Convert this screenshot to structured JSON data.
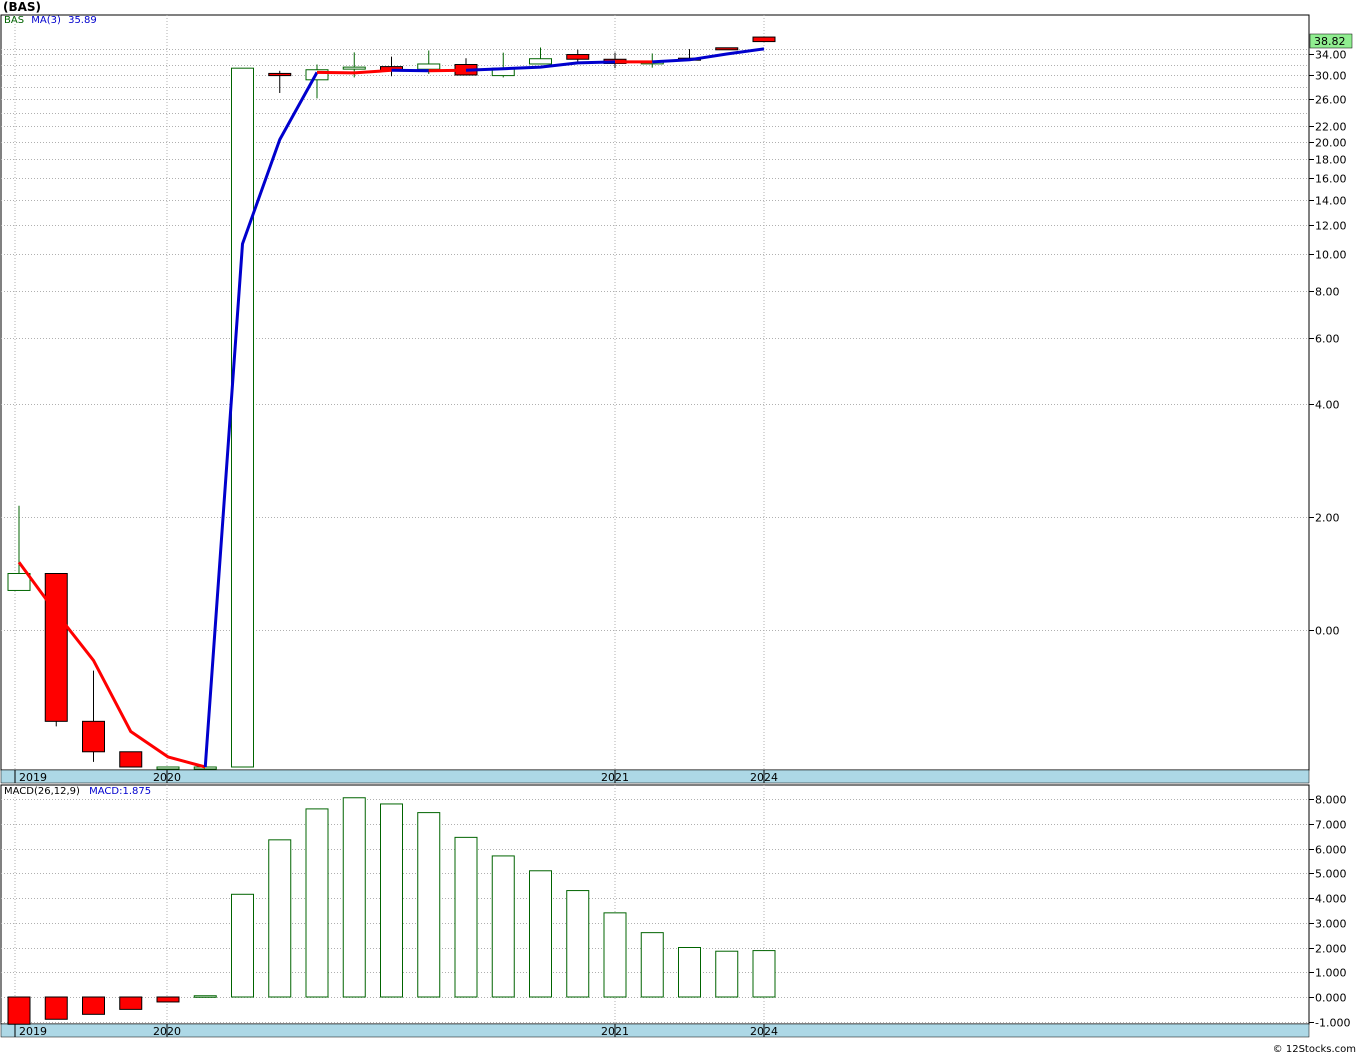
{
  "title": "(BAS)",
  "copyright": "© 12Stocks.com",
  "colors": {
    "up_candle": "#006400",
    "down_candle": "#ff0000",
    "ma_red": "#ff0000",
    "ma_blue": "#0000cd",
    "date_bar": "#add8e6",
    "grid": "#b0b0b0",
    "price_badge": "#90ee90"
  },
  "chart_data": [
    {
      "type": "candlestick",
      "ticker": "BAS",
      "legend": {
        "symbol": "BAS",
        "ma_label": "MA(3)",
        "ma_value": "35.89"
      },
      "scale": "nonlinear",
      "y_ticks": [
        "34.00",
        "30.00",
        "26.00",
        "22.00",
        "20.00",
        "18.00",
        "16.00",
        "14.00",
        "12.00",
        "10.00",
        "8.00",
        "6.00",
        "4.00",
        "2.00",
        "0.00"
      ],
      "last_price": "38.82",
      "x_tick_labels": [
        "2019",
        "2020",
        "2021",
        "2024"
      ],
      "candles": [
        {
          "open": 0.7,
          "high": 2.2,
          "low": 0.7,
          "close": 1.0
        },
        {
          "open": 1.0,
          "high": 1.0,
          "low": -1.9,
          "close": -1.8
        },
        {
          "open": -1.8,
          "high": -0.8,
          "low": -2.6,
          "close": -2.4
        },
        {
          "open": -2.4,
          "high": -2.6,
          "low": -2.6,
          "close": -2.7
        },
        {
          "open": -2.7,
          "high": -2.7,
          "low": -2.7,
          "close": -2.7
        },
        {
          "open": -2.7,
          "high": -2.7,
          "low": -2.7,
          "close": -2.7
        },
        {
          "open": -2.7,
          "high": 31.3,
          "low": -2.7,
          "close": 31.3
        },
        {
          "open": 30.3,
          "high": 30.8,
          "low": 27.0,
          "close": 29.9
        },
        {
          "open": 29.2,
          "high": 32.0,
          "low": 26.1,
          "close": 31.0
        },
        {
          "open": 31.2,
          "high": 34.6,
          "low": 29.6,
          "close": 31.5
        },
        {
          "open": 31.6,
          "high": 33.5,
          "low": 29.8,
          "close": 30.9
        },
        {
          "open": 31.1,
          "high": 35.3,
          "low": 30.2,
          "close": 32.1
        },
        {
          "open": 32.0,
          "high": 33.2,
          "low": 30.0,
          "close": 30.0
        },
        {
          "open": 29.9,
          "high": 34.5,
          "low": 29.6,
          "close": 31.3
        },
        {
          "open": 32.1,
          "high": 36.4,
          "low": 32.0,
          "close": 33.1
        },
        {
          "open": 33.9,
          "high": 35.6,
          "low": 32.1,
          "close": 33.0
        },
        {
          "open": 33.0,
          "high": 34.5,
          "low": 31.3,
          "close": 32.2
        },
        {
          "open": 32.5,
          "high": 34.2,
          "low": 31.4,
          "close": 32.5
        },
        {
          "open": 33.2,
          "high": 35.8,
          "low": 33.2,
          "close": 33.0
        },
        {
          "open": 36.3,
          "high": 36.4,
          "low": 35.7,
          "close": 36.0
        },
        {
          "open": 39.4,
          "high": 39.4,
          "low": 38.5,
          "close": 38.6
        }
      ],
      "moving_average": [
        1.2,
        0.3,
        -0.6,
        -2.0,
        -2.5,
        -2.7,
        10.7,
        20.3,
        30.5,
        30.4,
        30.9,
        30.8,
        30.9,
        31.2,
        31.5,
        32.3,
        32.5,
        32.5,
        32.9,
        34.0,
        35.9
      ],
      "ma_color_segments": [
        {
          "from": 0,
          "to": 5,
          "color": "red"
        },
        {
          "from": 5,
          "to": 8,
          "color": "blue"
        },
        {
          "from": 8,
          "to": 10,
          "color": "red"
        },
        {
          "from": 10,
          "to": 11,
          "color": "blue"
        },
        {
          "from": 11,
          "to": 12,
          "color": "red"
        },
        {
          "from": 12,
          "to": 16,
          "color": "blue"
        },
        {
          "from": 16,
          "to": 17,
          "color": "red"
        },
        {
          "from": 17,
          "to": 20,
          "color": "blue"
        }
      ]
    },
    {
      "type": "bar",
      "legend": {
        "label": "MACD(26,12,9)",
        "value_label": "MACD:1.875"
      },
      "ylim": [
        -1.0,
        8.0
      ],
      "y_ticks": [
        "8.000",
        "7.000",
        "6.000",
        "5.000",
        "4.000",
        "3.000",
        "2.000",
        "1.000",
        "0.000",
        "-1.000"
      ],
      "x_tick_labels": [
        "2019",
        "2020",
        "2021",
        "2024"
      ],
      "values": [
        -1.1,
        -0.9,
        -0.7,
        -0.5,
        -0.2,
        0.05,
        4.15,
        6.35,
        7.6,
        8.05,
        7.8,
        7.45,
        6.45,
        5.7,
        5.1,
        4.3,
        3.4,
        2.6,
        2.0,
        1.85,
        1.875
      ]
    }
  ]
}
